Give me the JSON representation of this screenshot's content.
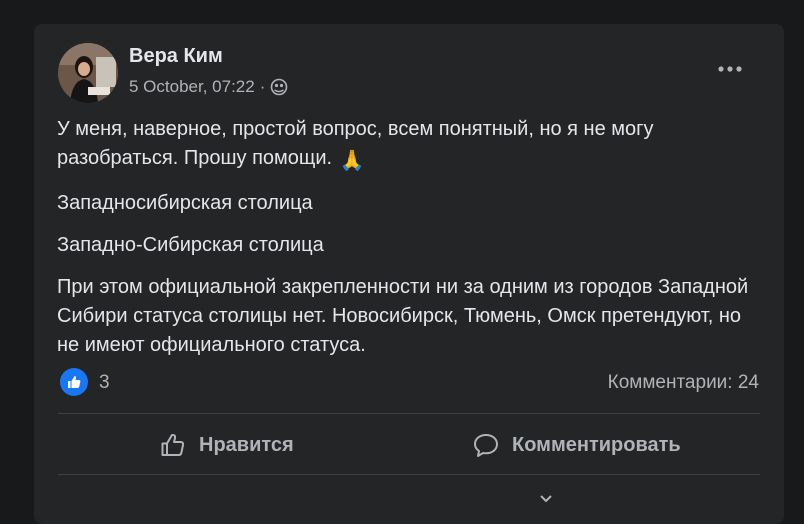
{
  "post": {
    "author": "Вера Ким",
    "date": "5 October, 07:22",
    "separator": "·",
    "visibility_icon": "public-globe-icon",
    "paragraphs": [
      "У меня, наверное, простой вопрос, всем понятный, но я не могу разобраться.  Прошу помощи.",
      "Западносибирская столица",
      "Западно-Сибирская столица",
      "При этом официальной закрепленности ни за одним из городов Западной Сибири статуса столицы нет. Новосибирск, Тюмень, Омск претендуют, но не имеют официального статуса."
    ],
    "emoji": "🙏"
  },
  "reactions": {
    "like_count": "3",
    "comments_label": "Комментарии: 24"
  },
  "actions": {
    "like_label": "Нравится",
    "comment_label": "Комментировать"
  },
  "colors": {
    "background": "#18191a",
    "card": "#242526",
    "text_primary": "#e4e6eb",
    "text_secondary": "#b0b3b8",
    "accent": "#1877f2"
  }
}
